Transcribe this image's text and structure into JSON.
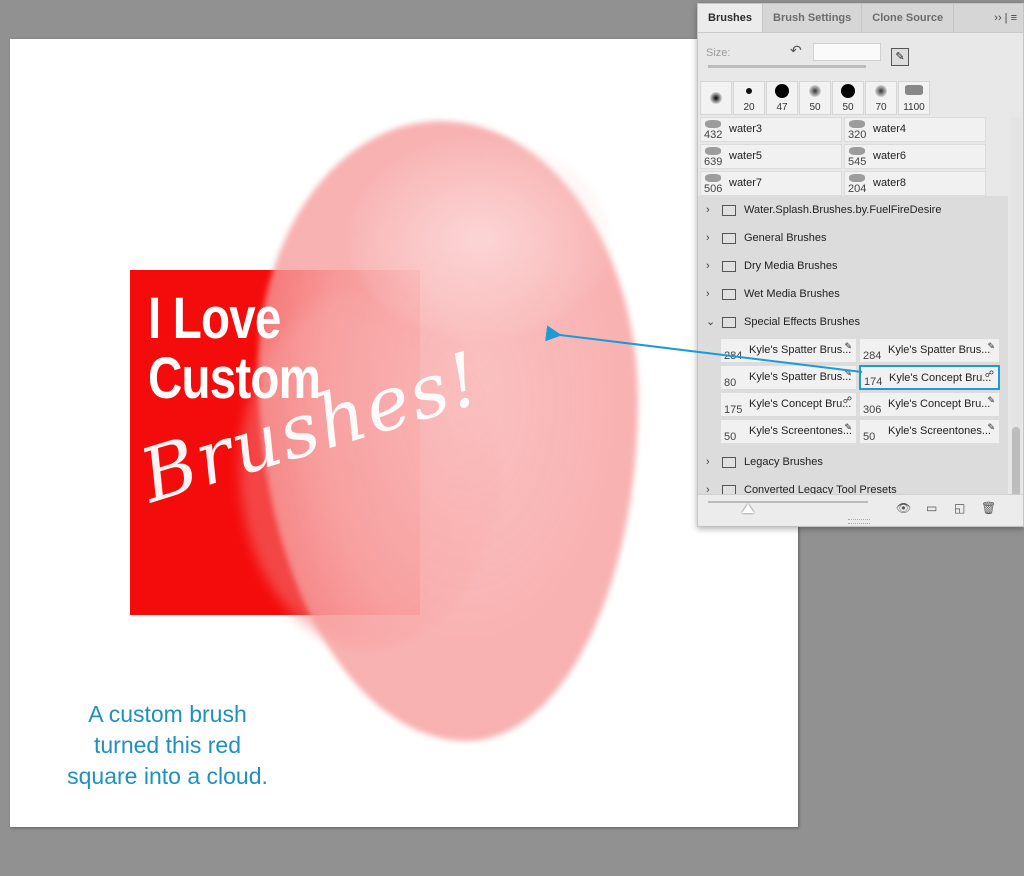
{
  "canvas": {
    "headline_line1": "I Love",
    "headline_line2": "Custom",
    "script_text": "Brushes!",
    "caption_line1": "A custom brush",
    "caption_line2": "turned this red",
    "caption_line3": "square into a cloud.",
    "colors": {
      "red": "#f40c0c",
      "cloud": "#f8b4b4",
      "caption": "#1e90bf",
      "arrow": "#1d9bd7"
    }
  },
  "panel": {
    "tabs": [
      {
        "label": "Brushes",
        "active": true
      },
      {
        "label": "Brush Settings",
        "active": false
      },
      {
        "label": "Clone Source",
        "active": false
      }
    ],
    "tab_menu": "›› | ≡",
    "size_label": "Size:",
    "size_value": "",
    "presets": [
      "",
      "20",
      "47",
      "50",
      "50",
      "70",
      "1100"
    ],
    "water_brushes": [
      {
        "size": "432",
        "name": "water3"
      },
      {
        "size": "320",
        "name": "water4"
      },
      {
        "size": "639",
        "name": "water5"
      },
      {
        "size": "545",
        "name": "water6"
      },
      {
        "size": "506",
        "name": "water7"
      },
      {
        "size": "204",
        "name": "water8"
      }
    ],
    "groups_before": [
      "Water.Splash.Brushes.by.FuelFireDesire",
      "General Brushes",
      "Dry Media Brushes",
      "Wet Media Brushes"
    ],
    "expanded_group": "Special Effects Brushes",
    "special_brushes": [
      {
        "size": "284",
        "name": "Kyle's Spatter Brus...",
        "selected": false
      },
      {
        "size": "284",
        "name": "Kyle's Spatter Brus...",
        "selected": false
      },
      {
        "size": "80",
        "name": "Kyle's Spatter Brus...",
        "selected": false
      },
      {
        "size": "174",
        "name": "Kyle's Concept Bru...",
        "selected": true
      },
      {
        "size": "175",
        "name": "Kyle's Concept Bru...",
        "selected": false
      },
      {
        "size": "306",
        "name": "Kyle's Concept Bru...",
        "selected": false
      },
      {
        "size": "50",
        "name": "Kyle's Screentones...",
        "selected": false
      },
      {
        "size": "50",
        "name": "Kyle's Screentones...",
        "selected": false
      }
    ],
    "groups_after": [
      "Legacy Brushes",
      "Converted Legacy Tool Presets"
    ],
    "footer_icons": [
      "eye-brush-icon",
      "new-group-icon",
      "new-brush-icon",
      "trash-icon"
    ]
  }
}
